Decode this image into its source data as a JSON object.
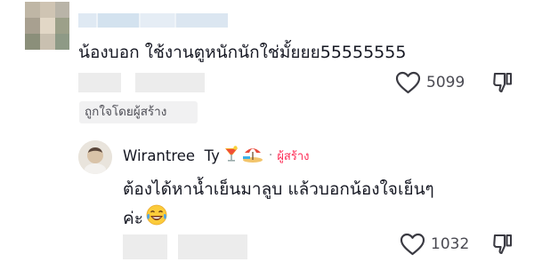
{
  "comment": {
    "text": "น้องบอก ใช้งานตูหนักนักใช่มั้ยยย55555555",
    "likes": "5099",
    "liked_by_creator": "ถูกใจโดยผู้สร้าง"
  },
  "reply": {
    "author": "Wirantree  Ty",
    "author_emojis": [
      "cocktail-emoji",
      "beach-umbrella-emoji"
    ],
    "separator": "·",
    "creator_label": "ผู้สร้าง",
    "text_line1": "ต้องได้หาน้ำเย็นมาลูบ แล้วบอกน้องใจเย็นๆ",
    "text_line2": "ค่ะ",
    "text_emoji": "laughing-tears-emoji",
    "likes": "1032"
  },
  "colors": {
    "accent": "#fe2c55",
    "text": "#161823",
    "muted": "#4a4a52",
    "blur": "#ececec"
  }
}
